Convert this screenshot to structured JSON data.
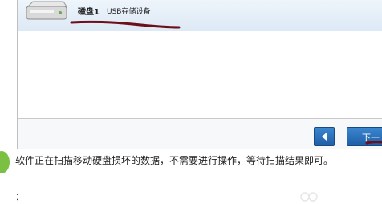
{
  "device_list": {
    "items": [
      {
        "name": "磁盘1",
        "description": "USB存储设备",
        "icon": "hard-drive-icon",
        "selected": true
      }
    ]
  },
  "navigation": {
    "prev_icon": "arrow-left-icon",
    "next_label": "下一"
  },
  "step": {
    "instruction": "软件正在扫描移动硬盘损坏的数据，不需要进行操作，等待扫描结果即可。",
    "continuation": "："
  },
  "colors": {
    "selected_row": "#dde9f5",
    "button_blue": "#2a6fb8",
    "annotation_red": "#6b0f1a",
    "step_green": "#7bc043"
  }
}
